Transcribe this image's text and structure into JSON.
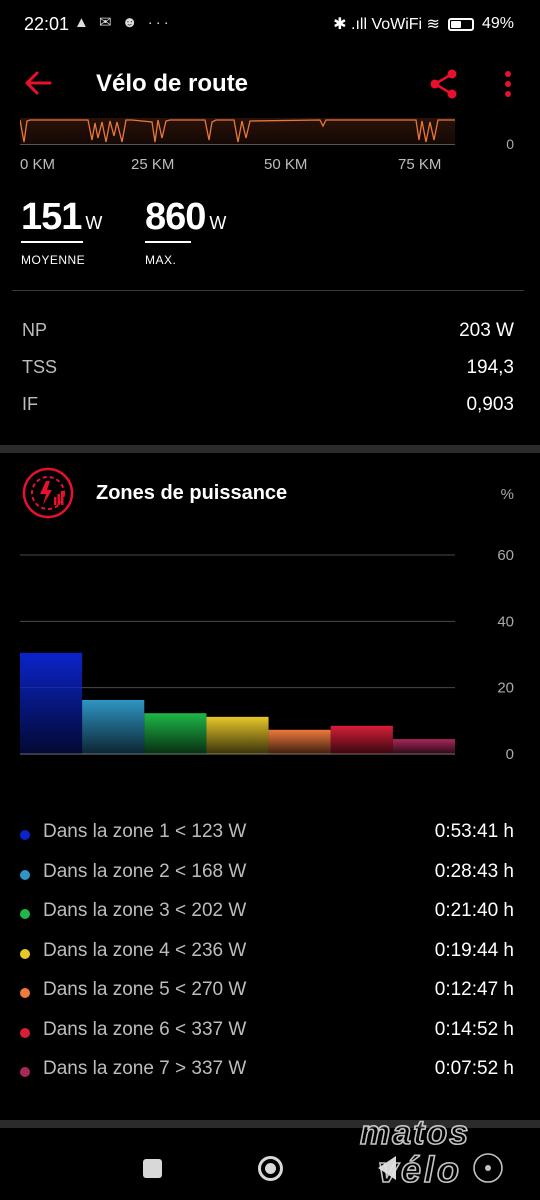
{
  "status_bar": {
    "time": "22:01",
    "left_icons": "▲ ✉ ☻ ···",
    "right_icons": "✱ .ıll VoWiFi ≋",
    "battery_percent": "49%",
    "battery_level": 0.49
  },
  "header": {
    "title": "Vélo de route",
    "back_icon": "arrow-left-icon",
    "share_icon": "share-icon",
    "more_icon": "more-vertical-icon",
    "accent_color": "#e8112d"
  },
  "strip_chart": {
    "zero_label": "0",
    "km_labels": [
      "0 KM",
      "25 KM",
      "50 KM",
      "75 KM"
    ]
  },
  "stats": {
    "average": {
      "value": "151",
      "unit": "W",
      "caption": "MOYENNE"
    },
    "max": {
      "value": "860",
      "unit": "W",
      "caption": "MAX."
    }
  },
  "metrics": [
    {
      "label": "NP",
      "value": "203 W"
    },
    {
      "label": "TSS",
      "value": "194,3"
    },
    {
      "label": "IF",
      "value": "0,903"
    }
  ],
  "zones": {
    "title": "Zones de puissance",
    "unit": "%",
    "icon": "power-zones-icon",
    "rows": [
      {
        "label": "Dans la zone 1 < 123 W",
        "time": "0:53:41 h",
        "color": "#0b24c9"
      },
      {
        "label": "Dans la zone 2 < 168 W",
        "time": "0:28:43 h",
        "color": "#2f95c4"
      },
      {
        "label": "Dans la zone 3 < 202 W",
        "time": "0:21:40 h",
        "color": "#1eb748"
      },
      {
        "label": "Dans la zone 4 < 236 W",
        "time": "0:19:44 h",
        "color": "#e7c82a"
      },
      {
        "label": "Dans la zone 5 < 270 W",
        "time": "0:12:47 h",
        "color": "#ef7a3c"
      },
      {
        "label": "Dans la zone 6 < 337 W",
        "time": "0:14:52 h",
        "color": "#d81e3a"
      },
      {
        "label": "Dans la zone 7 > 337 W",
        "time": "0:07:52 h",
        "color": "#a8285a"
      }
    ]
  },
  "chart_data": {
    "type": "bar",
    "categories": [
      "1",
      "2",
      "3",
      "4",
      "5",
      "6",
      "7"
    ],
    "values": [
      30.5,
      16.3,
      12.3,
      11.2,
      7.3,
      8.5,
      4.5
    ],
    "colors": [
      "#0b24c9",
      "#2f95c4",
      "#1eb748",
      "#e7c82a",
      "#ef7a3c",
      "#d81e3a",
      "#a8285a"
    ],
    "ylim": [
      0,
      60
    ],
    "yticks": [
      "0",
      "20",
      "40",
      "60"
    ],
    "ylabel": "%",
    "grid": true
  },
  "watermark": "matos vélo"
}
